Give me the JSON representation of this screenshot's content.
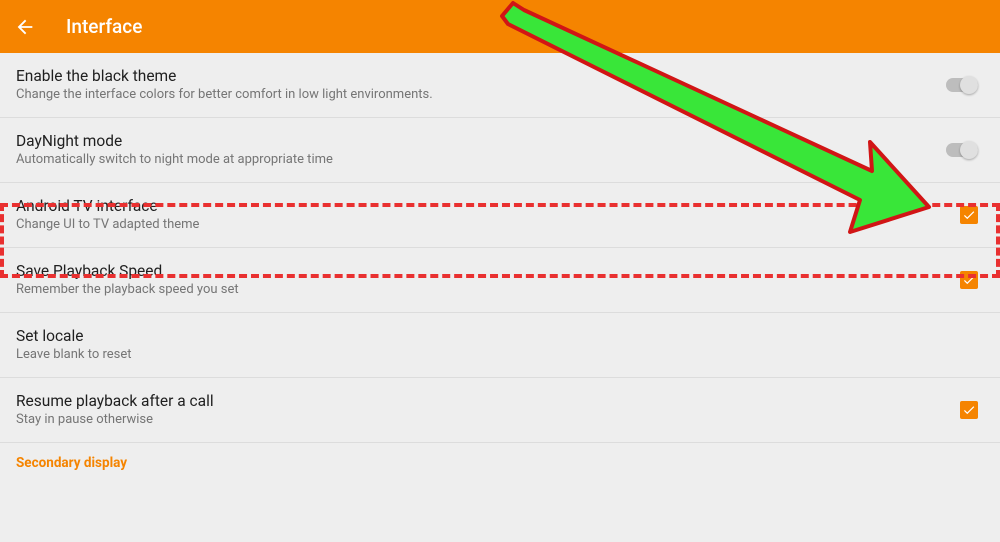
{
  "header": {
    "title": "Interface"
  },
  "items": [
    {
      "title": "Enable the black theme",
      "sub": "Change the interface colors for better comfort in low light environments.",
      "type": "switch",
      "on": false
    },
    {
      "title": "DayNight mode",
      "sub": "Automatically switch to night mode at appropriate time",
      "type": "switch",
      "on": false
    },
    {
      "title": "Android TV interface",
      "sub": "Change UI to TV adapted theme",
      "type": "checkbox",
      "checked": true
    },
    {
      "title": "Save Playback Speed",
      "sub": "Remember the playback speed you set",
      "type": "checkbox",
      "checked": true
    },
    {
      "title": "Set locale",
      "sub": "Leave blank to reset",
      "type": "none"
    },
    {
      "title": "Resume playback after a call",
      "sub": "Stay in pause otherwise",
      "type": "checkbox",
      "checked": true
    }
  ],
  "section": {
    "title": "Secondary display"
  }
}
